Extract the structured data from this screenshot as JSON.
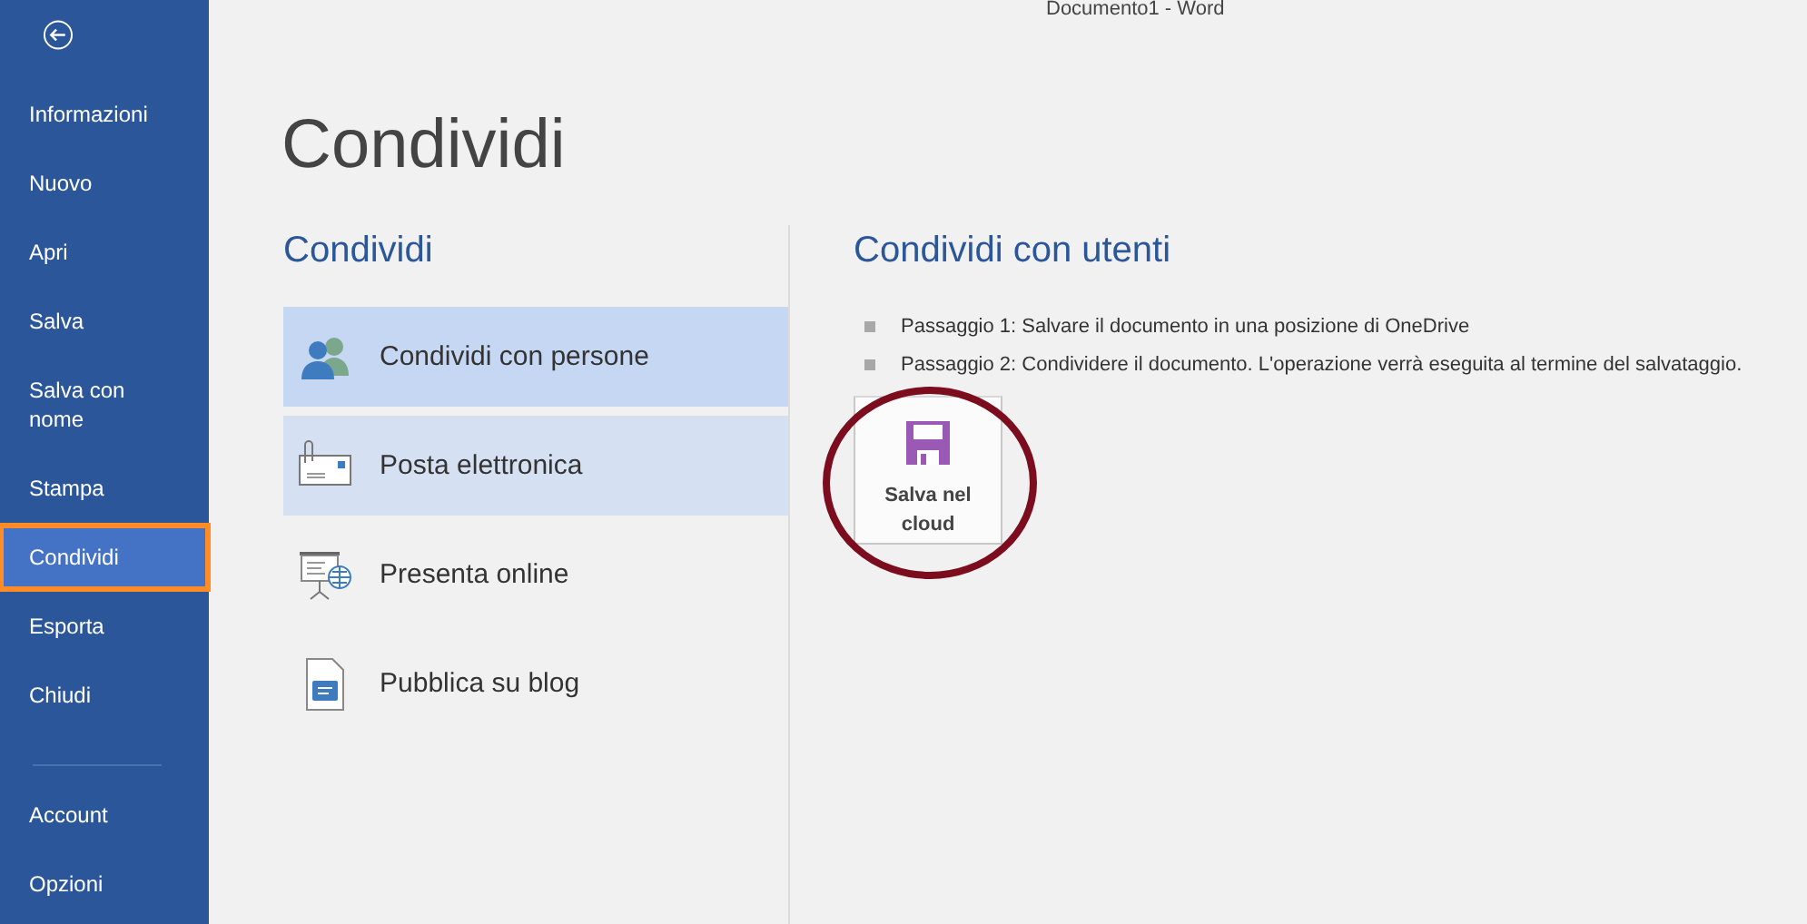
{
  "window": {
    "title": "Documento1 - Word"
  },
  "sidebar": {
    "items": [
      {
        "label": "Informazioni",
        "selected": false,
        "highlighted": false
      },
      {
        "label": "Nuovo",
        "selected": false,
        "highlighted": false
      },
      {
        "label": "Apri",
        "selected": false,
        "highlighted": false
      },
      {
        "label": "Salva",
        "selected": false,
        "highlighted": false
      },
      {
        "label": "Salva con nome",
        "selected": false,
        "highlighted": false
      },
      {
        "label": "Stampa",
        "selected": false,
        "highlighted": false
      },
      {
        "label": "Condividi",
        "selected": true,
        "highlighted": true
      },
      {
        "label": "Esporta",
        "selected": false,
        "highlighted": false
      },
      {
        "label": "Chiudi",
        "selected": false,
        "highlighted": false
      }
    ],
    "bottom_items": [
      {
        "label": "Account",
        "selected": false
      },
      {
        "label": "Opzioni",
        "selected": false
      }
    ]
  },
  "page_title": "Condividi",
  "options": {
    "heading": "Condividi",
    "items": [
      {
        "kind": "people",
        "label": "Condividi con persone",
        "selected": true,
        "hovered": false
      },
      {
        "kind": "email",
        "label": "Posta elettronica",
        "selected": false,
        "hovered": true
      },
      {
        "kind": "present",
        "label": "Presenta online",
        "selected": false,
        "hovered": false
      },
      {
        "kind": "blog",
        "label": "Pubblica su blog",
        "selected": false,
        "hovered": false
      }
    ]
  },
  "detail": {
    "heading": "Condividi con utenti",
    "steps": [
      "Passaggio 1: Salvare il documento in una posizione di OneDrive",
      "Passaggio 2: Condividere il documento. L'operazione verrà eseguita al termine del salvataggio."
    ],
    "button": {
      "label": "Salva nel cloud",
      "highlighted": true
    }
  }
}
